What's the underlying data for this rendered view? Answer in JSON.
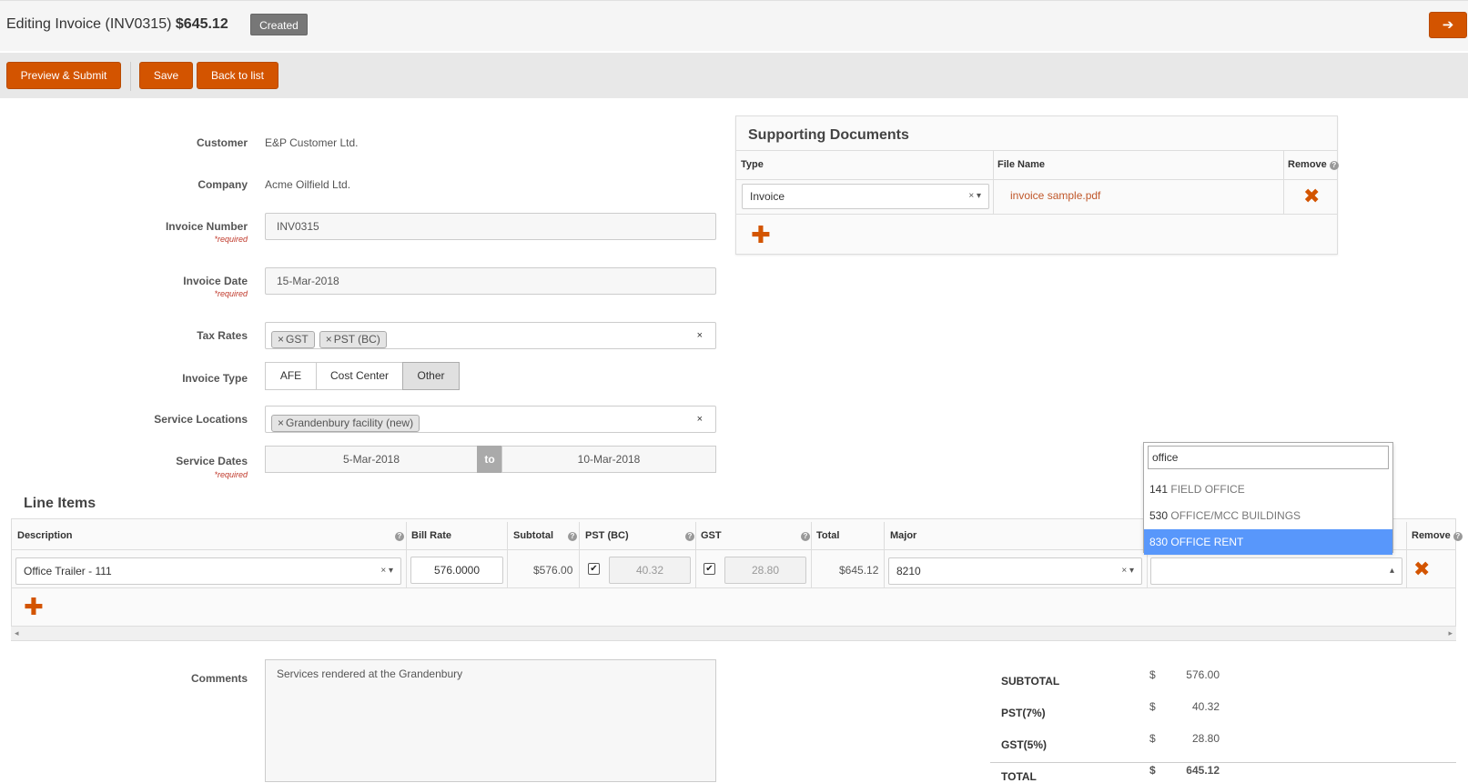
{
  "header": {
    "title_prefix": "Editing Invoice (INV0315)",
    "title_amount": "$645.12",
    "status": "Created",
    "next_icon": "arrow-right-icon"
  },
  "toolbar": {
    "preview_submit": "Preview & Submit",
    "save": "Save",
    "back": "Back to list"
  },
  "form": {
    "customer_label": "Customer",
    "customer_value": "E&P Customer Ltd.",
    "company_label": "Company",
    "company_value": "Acme Oilfield Ltd.",
    "invoice_number_label": "Invoice Number",
    "invoice_number_value": "INV0315",
    "required_text": "*required",
    "invoice_date_label": "Invoice Date",
    "invoice_date_value": "15-Mar-2018",
    "tax_rates_label": "Tax Rates",
    "tax_rates": [
      "GST",
      "PST (BC)"
    ],
    "invoice_type_label": "Invoice Type",
    "invoice_types": [
      "AFE",
      "Cost Center",
      "Other"
    ],
    "invoice_type_selected": "Other",
    "service_locations_label": "Service Locations",
    "service_locations": [
      "Grandenbury facility (new)"
    ],
    "service_dates_label": "Service Dates",
    "service_date_from": "5-Mar-2018",
    "service_date_sep": "to",
    "service_date_to": "10-Mar-2018",
    "tag_remove": "×",
    "clear": "×"
  },
  "docs": {
    "title": "Supporting Documents",
    "col_type": "Type",
    "col_file": "File Name",
    "col_remove": "Remove",
    "row_type": "Invoice",
    "row_file": "invoice sample.pdf",
    "clear": "×",
    "remove_icon": "✖",
    "add_icon": "✚"
  },
  "line_items": {
    "title": "Line Items",
    "columns": [
      "Description",
      "Bill Rate",
      "Subtotal",
      "PST (BC)",
      "GST",
      "Total",
      "Major",
      "Remove"
    ],
    "row": {
      "description": "Office Trailer - 111",
      "bill_rate": "576.0000",
      "subtotal": "$576.00",
      "pst": "40.32",
      "gst": "28.80",
      "total": "$645.12",
      "major": "8210",
      "minor": ""
    },
    "checkbox_mark": "✔",
    "remove_icon": "✖",
    "add_icon": "✚",
    "help_icon": "?"
  },
  "dropdown": {
    "search_value": "office",
    "options": [
      {
        "code": "141",
        "name": "FIELD OFFICE"
      },
      {
        "code": "530",
        "name": "OFFICE/MCC BUILDINGS"
      },
      {
        "code": "830",
        "name": "OFFICE RENT"
      }
    ],
    "highlighted": "830"
  },
  "comments": {
    "label": "Comments",
    "value": "Services rendered at the Grandenbury"
  },
  "totals": {
    "currency": "$",
    "subtotal_label": "SUBTOTAL",
    "subtotal": "576.00",
    "pst_label": "PST(7%)",
    "pst": "40.32",
    "gst_label": "GST(5%)",
    "gst": "28.80",
    "total_label": "TOTAL",
    "total": "645.12"
  },
  "colors": {
    "accent": "#d35400",
    "badge": "#777777",
    "highlight": "#5897fb"
  }
}
